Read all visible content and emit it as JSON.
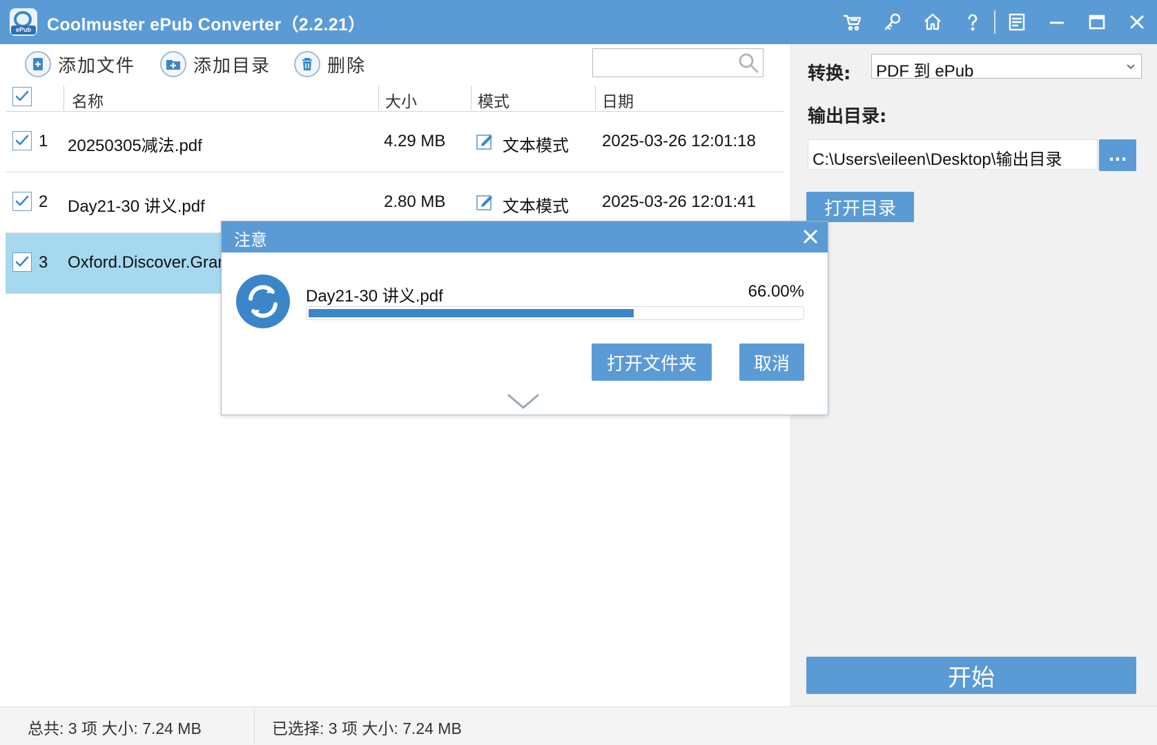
{
  "titlebar": {
    "logo_text": "ePub",
    "title": "Coolmuster ePub Converter（2.2.21）",
    "icons": [
      "cart-icon",
      "key-icon",
      "home-icon",
      "help-icon",
      "feedback-icon",
      "minimize-icon",
      "maximize-icon",
      "close-icon"
    ]
  },
  "toolbar": {
    "add_file": "添加文件",
    "add_folder": "添加目录",
    "delete": "删除",
    "search_placeholder": ""
  },
  "table": {
    "columns": [
      "名称",
      "大小",
      "模式",
      "日期"
    ],
    "rows": [
      {
        "index": "1",
        "name": "20250305减法.pdf",
        "size": "4.29 MB",
        "mode": "文本模式",
        "date": "2025-03-26 12:01:18",
        "checked": true
      },
      {
        "index": "2",
        "name": "Day21-30 讲义.pdf",
        "size": "2.80 MB",
        "mode": "文本模式",
        "date": "2025-03-26 12:01:41",
        "checked": true
      },
      {
        "index": "3",
        "name": "Oxford.Discover.Gran",
        "size": "",
        "mode": "",
        "date": "",
        "checked": true
      }
    ]
  },
  "right_panel": {
    "convert_label": "转换:",
    "convert_value": "PDF 到 ePub",
    "output_label": "输出目录:",
    "output_path": "C:\\Users\\eileen\\Desktop\\输出目录",
    "browse": "...",
    "open_dir": "打开目录",
    "start": "开始"
  },
  "statusbar": {
    "total": "总共:  3 项  大小:  7.24 MB",
    "selected": "已选择:  3 项  大小:  7.24 MB"
  },
  "dialog": {
    "title": "注意",
    "file": "Day21-30 讲义.pdf",
    "percent": "66.00%",
    "progress": 0.66,
    "open_folder": "打开文件夹",
    "cancel": "取消"
  },
  "colors": {
    "accent": "#5b9bd5",
    "progress": "#3b86c9",
    "row_selected": "#a6d8f0"
  }
}
